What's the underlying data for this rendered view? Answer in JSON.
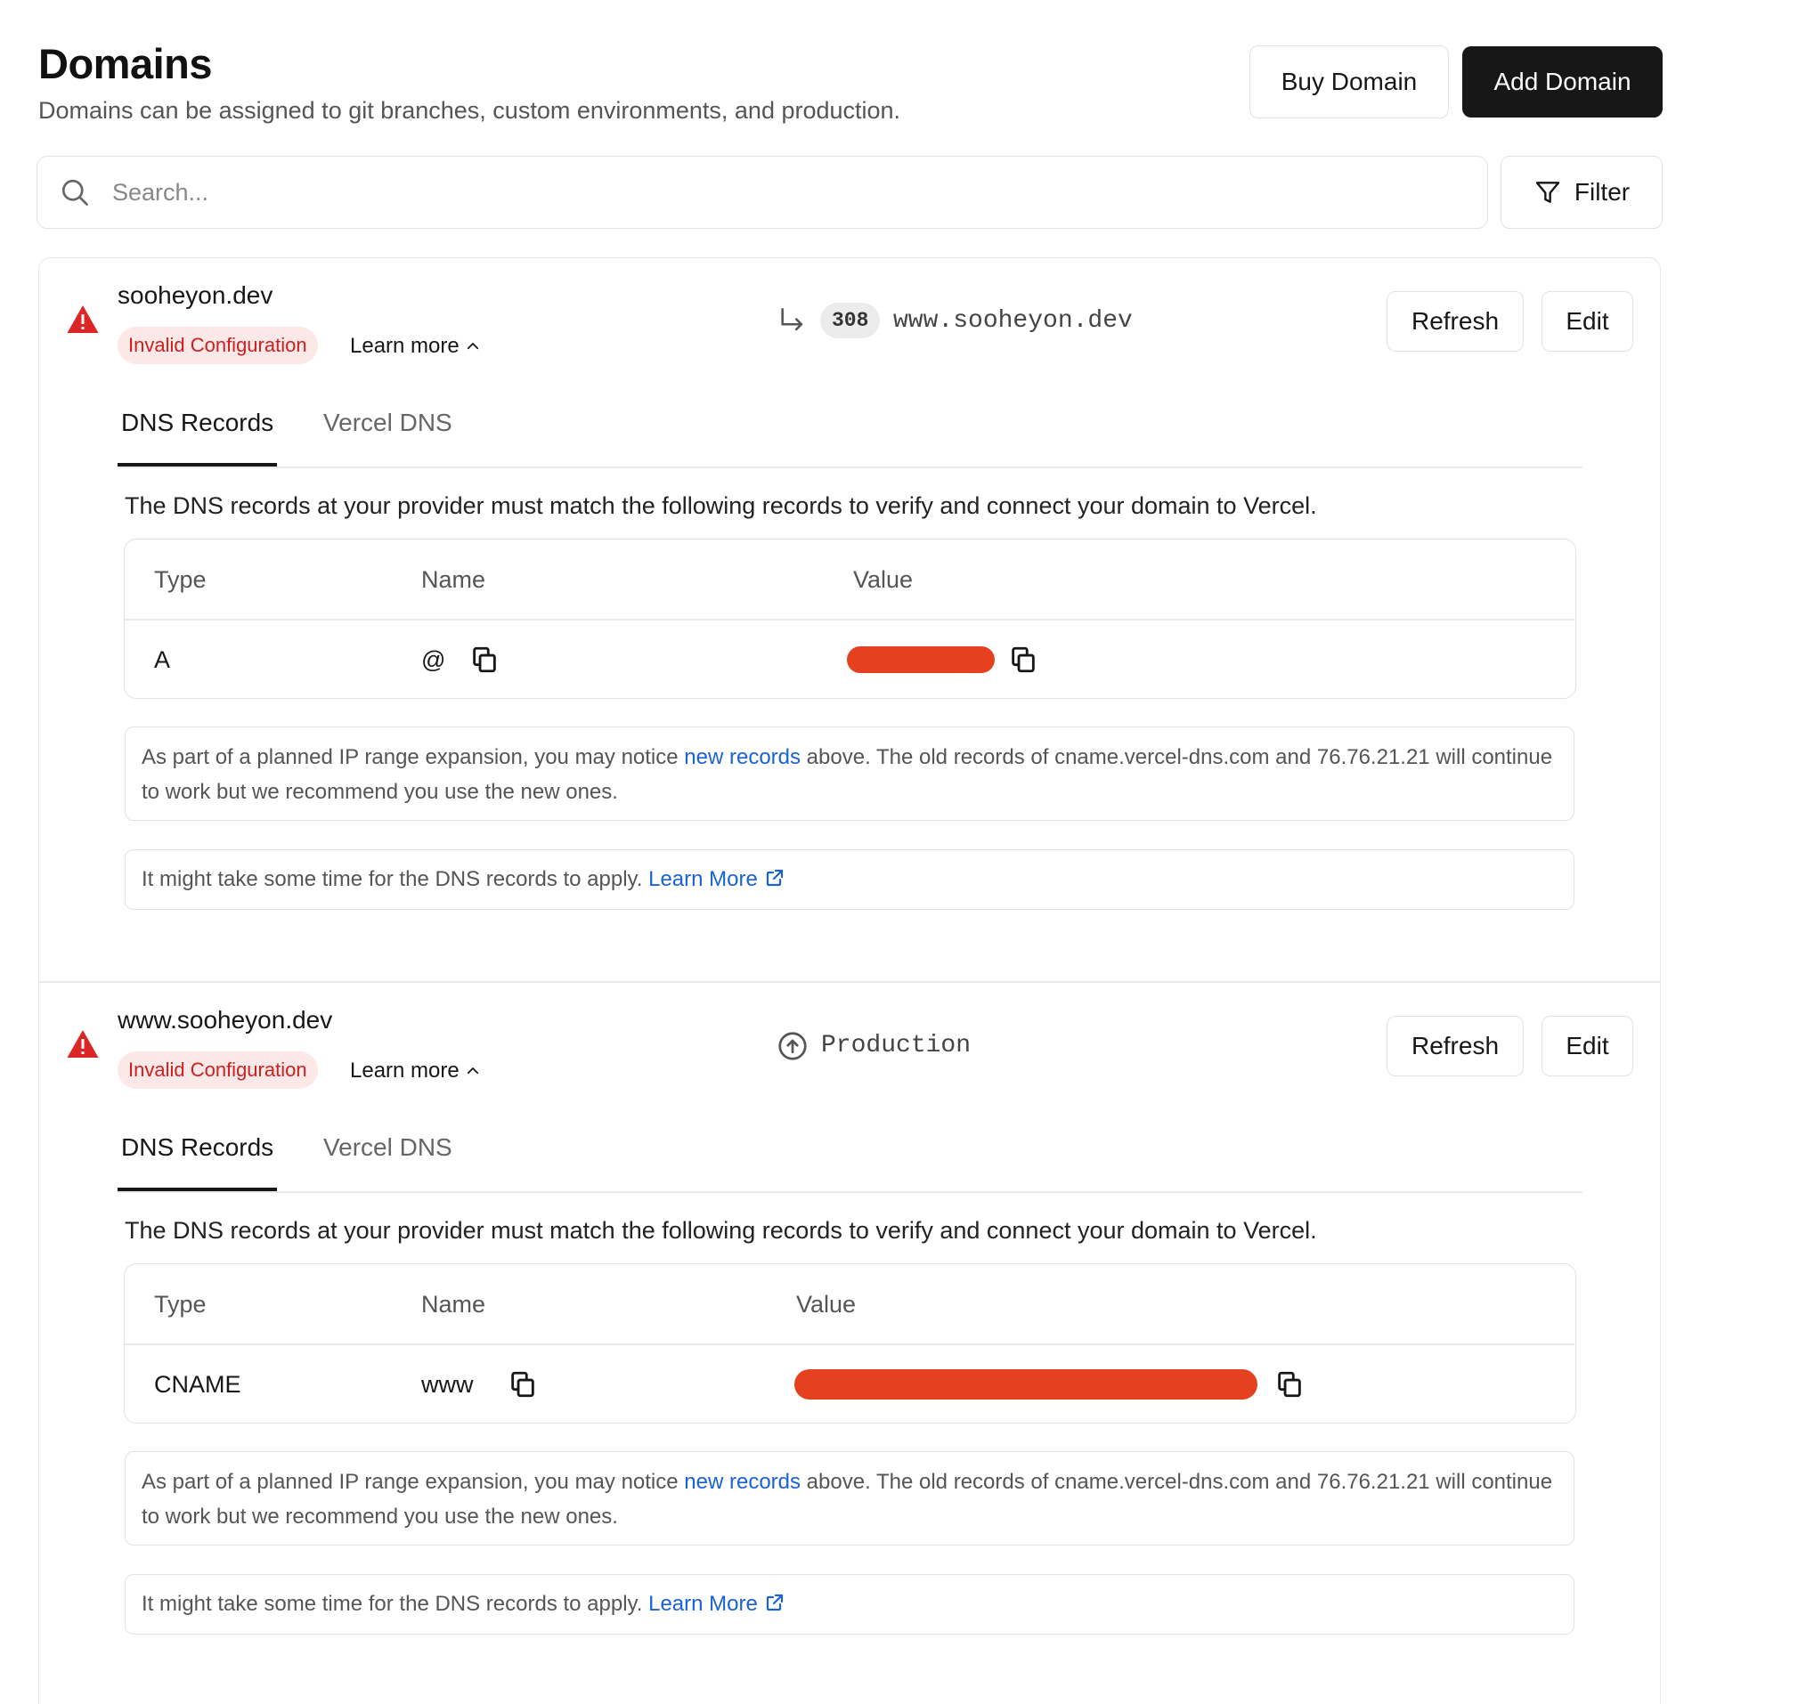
{
  "header": {
    "title": "Domains",
    "subtitle": "Domains can be assigned to git branches, custom environments, and production.",
    "buy_domain_label": "Buy Domain",
    "add_domain_label": "Add Domain"
  },
  "search": {
    "placeholder": "Search...",
    "value": "",
    "filter_label": "Filter"
  },
  "domains": [
    {
      "name": "sooheyon.dev",
      "status_badge": "Invalid Configuration",
      "learn_more_label": "Learn more",
      "redirect_code": "308",
      "redirect_target": "www.sooheyon.dev",
      "refresh_label": "Refresh",
      "edit_label": "Edit",
      "tabs": [
        "DNS Records",
        "Vercel DNS"
      ],
      "active_tab": "DNS Records",
      "description": "The DNS records at your provider must match the following records to verify and connect your domain to Vercel.",
      "table": {
        "headers": [
          "Type",
          "Name",
          "Value"
        ],
        "row": {
          "type": "A",
          "name": "@",
          "value": ""
        }
      },
      "notice_ip": {
        "before": "As part of a planned IP range expansion, you may notice ",
        "link": "new records",
        "after": " above. The old records of cname.vercel-dns.com and 76.76.21.21 will continue to work but we recommend you use the new ones."
      },
      "notice_time": {
        "text": "It might take some time for the DNS records to apply. ",
        "link": "Learn More"
      }
    },
    {
      "name": "www.sooheyon.dev",
      "status_badge": "Invalid Configuration",
      "learn_more_label": "Learn more",
      "environment": "Production",
      "refresh_label": "Refresh",
      "edit_label": "Edit",
      "tabs": [
        "DNS Records",
        "Vercel DNS"
      ],
      "active_tab": "DNS Records",
      "description": "The DNS records at your provider must match the following records to verify and connect your domain to Vercel.",
      "table": {
        "headers": [
          "Type",
          "Name",
          "Value"
        ],
        "row": {
          "type": "CNAME",
          "name": "www",
          "value": ""
        }
      },
      "notice_ip": {
        "before": "As part of a planned IP range expansion, you may notice ",
        "link": "new records",
        "after": " above. The old records of cname.vercel-dns.com and 76.76.21.21 will continue to work but we recommend you use the new ones."
      },
      "notice_time": {
        "text": "It might take some time for the DNS records to apply. ",
        "link": "Learn More"
      }
    }
  ],
  "colors": {
    "primary_dark": "#171717",
    "error_red": "#dc2626",
    "badge_bg": "#fde8e8",
    "link_blue": "#1a62d8",
    "redaction": "#e5401f"
  },
  "icons": {
    "search": "search-icon",
    "filter": "filter-icon",
    "warning": "warning-triangle-icon",
    "redirect": "redirect-arrow-icon",
    "production": "arrow-up-circle-icon",
    "copy": "copy-icon",
    "external": "external-link-icon",
    "chevron": "chevron-up-icon"
  }
}
